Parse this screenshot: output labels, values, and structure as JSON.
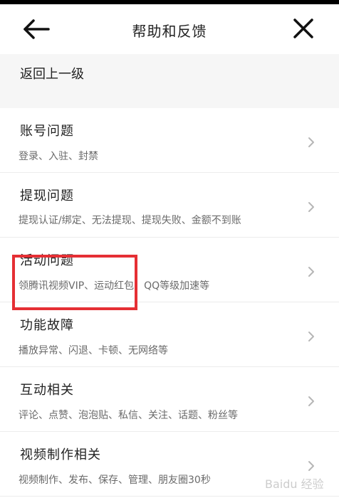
{
  "header": {
    "title": "帮助和反馈",
    "back_icon": "back-arrow-icon",
    "close_icon": "close-icon"
  },
  "back_row": {
    "label": "返回上一级"
  },
  "items": [
    {
      "title": "账号问题",
      "subtitle": "登录、入驻、封禁"
    },
    {
      "title": "提现问题",
      "subtitle": "提现认证/绑定、无法提现、提现失败、金额不到账"
    },
    {
      "title": "活动问题",
      "subtitle": "领腾讯视频VIP、运动红包、QQ等级加速等"
    },
    {
      "title": "功能故障",
      "subtitle": "播放异常、闪退、卡顿、无网络等"
    },
    {
      "title": "互动相关",
      "subtitle": "评论、点赞、泡泡贴、私信、关注、话题、粉丝等"
    },
    {
      "title": "视频制作相关",
      "subtitle": "视频制作、发布、保存、管理、朋友圈30秒"
    }
  ],
  "highlight": {
    "color": "#e52f34"
  },
  "watermark": {
    "text": "Baidu 经验"
  }
}
